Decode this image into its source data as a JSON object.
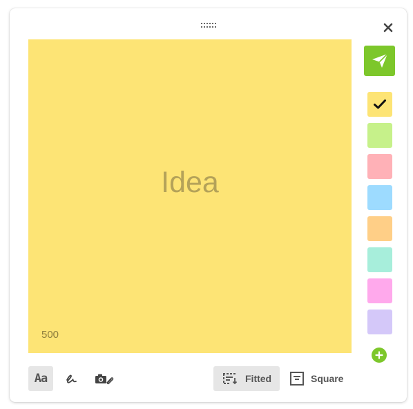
{
  "note": {
    "placeholder": "Idea",
    "char_counter": "500",
    "background_color": "#fde475"
  },
  "post_button": {
    "icon": "paper-plane-icon",
    "color": "#7dc72b"
  },
  "color_swatches": [
    {
      "name": "yellow",
      "color": "#fde475",
      "selected": true
    },
    {
      "name": "green",
      "color": "#c6f18a",
      "selected": false
    },
    {
      "name": "red",
      "color": "#ffb1b7",
      "selected": false
    },
    {
      "name": "blue",
      "color": "#9ddbff",
      "selected": false
    },
    {
      "name": "orange",
      "color": "#ffcf87",
      "selected": false
    },
    {
      "name": "teal",
      "color": "#a7eedb",
      "selected": false
    },
    {
      "name": "pink",
      "color": "#ffa9ec",
      "selected": false
    },
    {
      "name": "violet",
      "color": "#d4c8f9",
      "selected": false
    }
  ],
  "toolbar": {
    "text_tool_label": "Aa",
    "draw_tool_icon": "pen-scribble-icon",
    "media_tool_icon": "camera-attachment-icon",
    "fitted_label": "Fitted",
    "square_label": "Square",
    "active_size": "Fitted"
  }
}
